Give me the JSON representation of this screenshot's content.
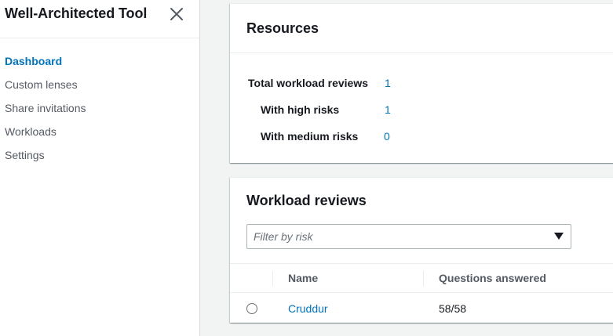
{
  "sidebar": {
    "title": "Well-Architected Tool",
    "close_icon": "close-icon",
    "items": [
      {
        "label": "Dashboard",
        "active": true
      },
      {
        "label": "Custom lenses",
        "active": false
      },
      {
        "label": "Share invitations",
        "active": false
      },
      {
        "label": "Workloads",
        "active": false
      },
      {
        "label": "Settings",
        "active": false
      }
    ]
  },
  "resources": {
    "title": "Resources",
    "stats": [
      {
        "label": "Total workload reviews",
        "value": "1"
      },
      {
        "label": "With high risks",
        "value": "1"
      },
      {
        "label": "With medium risks",
        "value": "0"
      }
    ]
  },
  "workload_reviews": {
    "title": "Workload reviews",
    "filter_placeholder": "Filter by risk",
    "columns": [
      "Name",
      "Questions answered"
    ],
    "rows": [
      {
        "name": "Cruddur",
        "questions_answered": "58/58"
      }
    ]
  },
  "colors": {
    "accent_link": "#0073bb",
    "text": "#16191f",
    "muted": "#545b64",
    "background": "#f2f3f3"
  }
}
